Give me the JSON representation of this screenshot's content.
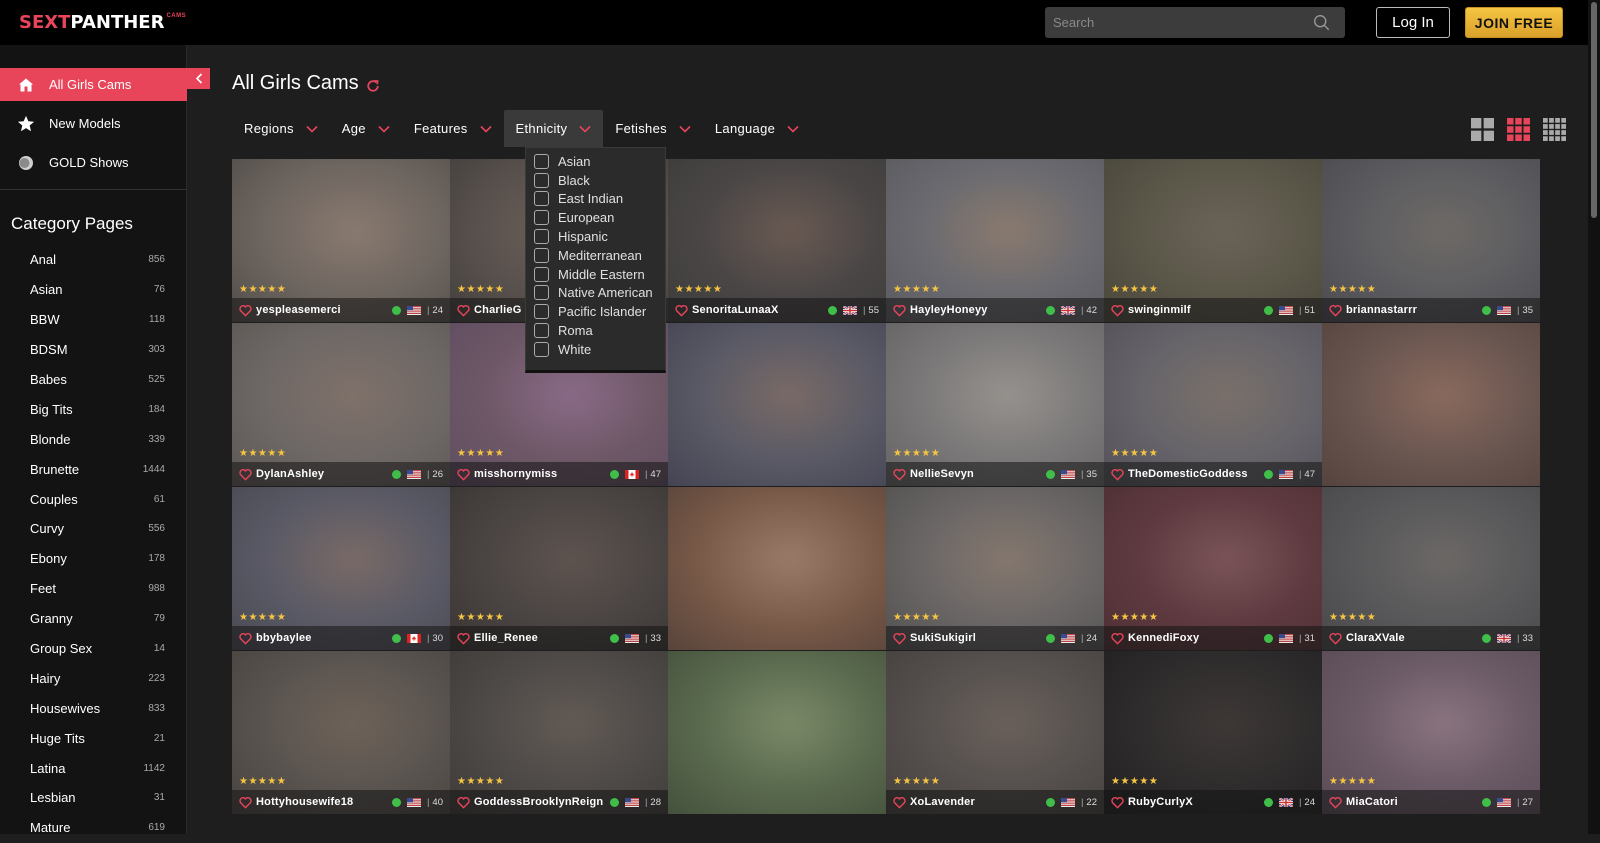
{
  "header": {
    "logo": {
      "part1": "SEXT",
      "part2": "PANTHER",
      "part3": "CAMS"
    },
    "search_placeholder": "Search",
    "login_label": "Log In",
    "join_label": "JOIN FREE"
  },
  "sidebar": {
    "nav": [
      {
        "label": "All Girls Cams",
        "icon": "home-icon"
      },
      {
        "label": "New Models",
        "icon": "star-icon"
      },
      {
        "label": "GOLD Shows",
        "icon": "gold-coin-icon"
      }
    ],
    "category_title": "Category Pages",
    "categories": [
      {
        "name": "Anal",
        "count": "856"
      },
      {
        "name": "Asian",
        "count": "76"
      },
      {
        "name": "BBW",
        "count": "118"
      },
      {
        "name": "BDSM",
        "count": "303"
      },
      {
        "name": "Babes",
        "count": "525"
      },
      {
        "name": "Big Tits",
        "count": "184"
      },
      {
        "name": "Blonde",
        "count": "339"
      },
      {
        "name": "Brunette",
        "count": "1444"
      },
      {
        "name": "Couples",
        "count": "61"
      },
      {
        "name": "Curvy",
        "count": "556"
      },
      {
        "name": "Ebony",
        "count": "178"
      },
      {
        "name": "Feet",
        "count": "988"
      },
      {
        "name": "Granny",
        "count": "79"
      },
      {
        "name": "Group Sex",
        "count": "14"
      },
      {
        "name": "Hairy",
        "count": "223"
      },
      {
        "name": "Housewives",
        "count": "833"
      },
      {
        "name": "Huge Tits",
        "count": "21"
      },
      {
        "name": "Latina",
        "count": "1142"
      },
      {
        "name": "Lesbian",
        "count": "31"
      },
      {
        "name": "Mature",
        "count": "619"
      }
    ]
  },
  "main": {
    "title": "All Girls Cams",
    "filters": [
      "Regions",
      "Age",
      "Features",
      "Ethnicity",
      "Fetishes",
      "Language"
    ],
    "open_filter": "Ethnicity",
    "ethnicity_options": [
      "Asian",
      "Black",
      "East Indian",
      "European",
      "Hispanic",
      "Mediterranean",
      "Middle Eastern",
      "Native American",
      "Pacific Islander",
      "Roma",
      "White"
    ]
  },
  "colors": {
    "accent": "#e8455b",
    "gold": "#f5c542",
    "online": "#3fbf4a"
  },
  "tiles": [
    {
      "name": "yespleasemerci",
      "flag": "us",
      "age": "24",
      "stars": "★★★★★",
      "c1": "#6e6660",
      "c2": "#4a4644",
      "c3": "#8a7a70"
    },
    {
      "name": "CharlieG",
      "flag": "us",
      "age": "",
      "stars": "★★★★★",
      "c1": "#5a524e",
      "c2": "#3d3a38",
      "c3": "#6f625a"
    },
    {
      "name": "SenoritaLunaaX",
      "flag": "gb",
      "age": "55",
      "stars": "★★★★★",
      "c1": "#4a4646",
      "c2": "#3a3838",
      "c3": "#6a5a52"
    },
    {
      "name": "HayleyHoneyy",
      "flag": "gb",
      "age": "42",
      "stars": "★★★★★",
      "c1": "#6a6a70",
      "c2": "#55555a",
      "c3": "#8a7a6e"
    },
    {
      "name": "swinginmilf",
      "flag": "us",
      "age": "51",
      "stars": "★★★★★",
      "c1": "#5a5648",
      "c2": "#454238",
      "c3": "#6a6458"
    },
    {
      "name": "briannastarrr",
      "flag": "us",
      "age": "35",
      "stars": "★★★★★",
      "c1": "#5c5c60",
      "c2": "#47474b",
      "c3": "#6e6a66"
    },
    {
      "name": "DylanAshley",
      "flag": "us",
      "age": "26",
      "stars": "★★★★★",
      "c1": "#6e6866",
      "c2": "#58524f",
      "c3": "#80716a"
    },
    {
      "name": "misshornymiss",
      "flag": "ca",
      "age": "47",
      "stars": "★★★★★",
      "c1": "#6e5866",
      "c2": "#5a4a60",
      "c3": "#8a6a88"
    },
    {
      "name": "",
      "flag": "",
      "age": "",
      "stars": "",
      "c1": "#5a5a66",
      "c2": "#3e3e4e",
      "c3": "#7a6a66"
    },
    {
      "name": "NellieSevyn",
      "flag": "us",
      "age": "35",
      "stars": "★★★★★",
      "c1": "#7a7878",
      "c2": "#5e5c5c",
      "c3": "#96928e"
    },
    {
      "name": "TheDomesticGoddess",
      "flag": "us",
      "age": "47",
      "stars": "★★★★★",
      "c1": "#66646a",
      "c2": "#4e4c52",
      "c3": "#7a706a"
    },
    {
      "name": "",
      "flag": "",
      "age": "",
      "stars": "",
      "c1": "#6a5650",
      "c2": "#503e3a",
      "c3": "#8a6a5e"
    },
    {
      "name": "bbybaylee",
      "flag": "ca",
      "age": "30",
      "stars": "★★★★★",
      "c1": "#5a5a66",
      "c2": "#45454e",
      "c3": "#7a6a66"
    },
    {
      "name": "Ellie_Renee",
      "flag": "us",
      "age": "33",
      "stars": "★★★★★",
      "c1": "#4a4442",
      "c2": "#363230",
      "c3": "#5e5450"
    },
    {
      "name": "",
      "flag": "",
      "age": "",
      "stars": "",
      "c1": "#7a5a48",
      "c2": "#4e3e38",
      "c3": "#9a7a68"
    },
    {
      "name": "SukiSukigirl",
      "flag": "us",
      "age": "24",
      "stars": "★★★★★",
      "c1": "#6a6666",
      "c2": "#4c4a4a",
      "c3": "#85786e"
    },
    {
      "name": "KennediFoxy",
      "flag": "us",
      "age": "31",
      "stars": "★★★★★",
      "c1": "#5e3a40",
      "c2": "#4a2c30",
      "c3": "#7a5458"
    },
    {
      "name": "ClaraXVale",
      "flag": "gb",
      "age": "33",
      "stars": "★★★★★",
      "c1": "#58585a",
      "c2": "#444446",
      "c3": "#6c6866"
    },
    {
      "name": "Hottyhousewife18",
      "flag": "us",
      "age": "40",
      "stars": "★★★★★",
      "c1": "#5a5450",
      "c2": "#443f3c",
      "c3": "#6e6258"
    },
    {
      "name": "GoddessBrooklynReign",
      "flag": "us",
      "age": "28",
      "stars": "★★★★★",
      "c1": "#4e4a48",
      "c2": "#3a3634",
      "c3": "#625a54"
    },
    {
      "name": "",
      "flag": "",
      "age": "",
      "stars": "",
      "c1": "#5a6a4e",
      "c2": "#3e4a38",
      "c3": "#7a8a68"
    },
    {
      "name": "XoLavender",
      "flag": "us",
      "age": "22",
      "stars": "★★★★★",
      "c1": "#55504e",
      "c2": "#403c3a",
      "c3": "#6a605a"
    },
    {
      "name": "RubyCurlyX",
      "flag": "gb",
      "age": "24",
      "stars": "★★★★★",
      "c1": "#2e2c2c",
      "c2": "#1e1c1c",
      "c3": "#3e3836"
    },
    {
      "name": "MiaCatori",
      "flag": "us",
      "age": "27",
      "stars": "★★★★★",
      "c1": "#6a5a66",
      "c2": "#544652",
      "c3": "#8a7480"
    }
  ]
}
